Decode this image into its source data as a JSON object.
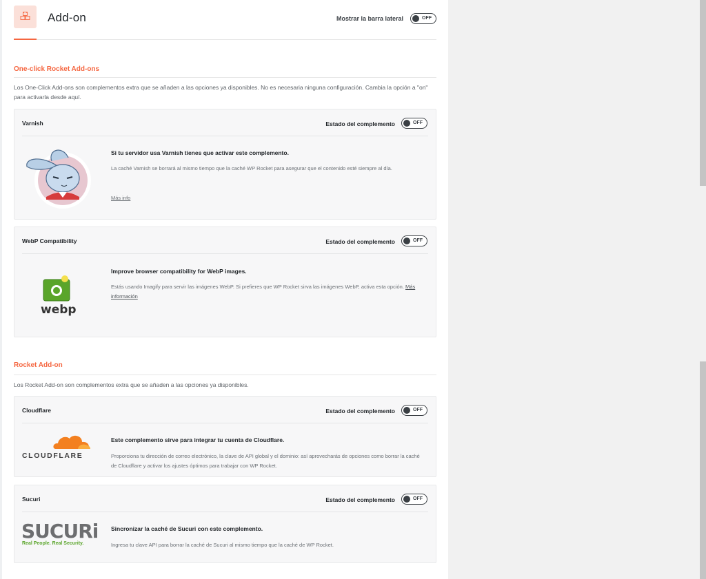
{
  "header": {
    "title": "Add-on",
    "sidebar_label": "Mostrar la barra lateral",
    "sidebar_toggle": "OFF"
  },
  "one_click": {
    "title": "One-click Rocket Add-ons",
    "description": "Los One-Click Add-ons son complementos extra que se añaden a las opciones ya disponibles. No es necesaria ninguna configuración. Cambia la opción a \"on\" para activarla desde aquí."
  },
  "rocket": {
    "title": "Rocket Add-on",
    "description": "Los Rocket Add-on son complementos extra que se añaden a las opciones ya disponibles."
  },
  "status_label": "Estado del complemento",
  "toggle_off": "OFF",
  "cards": {
    "varnish": {
      "name": "Varnish",
      "heading": "Si tu servidor usa Varnish tienes que activar este complemento.",
      "text": "La caché Varnish se borrará al mismo tiempo que la caché WP Rocket para asegurar que el contenido esté siempre al día.",
      "link": "Más info"
    },
    "webp": {
      "name": "WebP Compatibility",
      "heading": "Improve browser compatibility for WebP images.",
      "text": "Estás usando Imagify para servir las imágenes WebP. Si prefieres que WP Rocket sirva las imágenes WebP, activa esta opción.",
      "link": "Más información",
      "logo_text": "webp"
    },
    "cloudflare": {
      "name": "Cloudflare",
      "heading": "Este complemento sirve para integrar tu cuenta de Cloudflare.",
      "text": "Proporciona tu dirección de correo electrónico, la clave de API global y el dominio: así aprovecharás de opciones como borrar la caché de Cloudflare y activar los ajustes óptimos para trabajar con WP Rocket.",
      "logo_text": "CLOUDFLARE"
    },
    "sucuri": {
      "name": "Sucuri",
      "heading": "Sincronizar la caché de Sucuri con este complemento.",
      "text": "Ingresa tu clave API para borrar la caché de Sucuri al mismo tiempo que la caché de WP Rocket.",
      "logo_text": "SUCURi",
      "logo_tagline": "Real People. Real Security."
    }
  },
  "colors": {
    "accent": "#f56640",
    "webp_green": "#5aa52a",
    "cloudflare_orange": "#f38020",
    "sucuri_gray": "#6d6e70",
    "sucuri_green": "#5aa52a"
  }
}
